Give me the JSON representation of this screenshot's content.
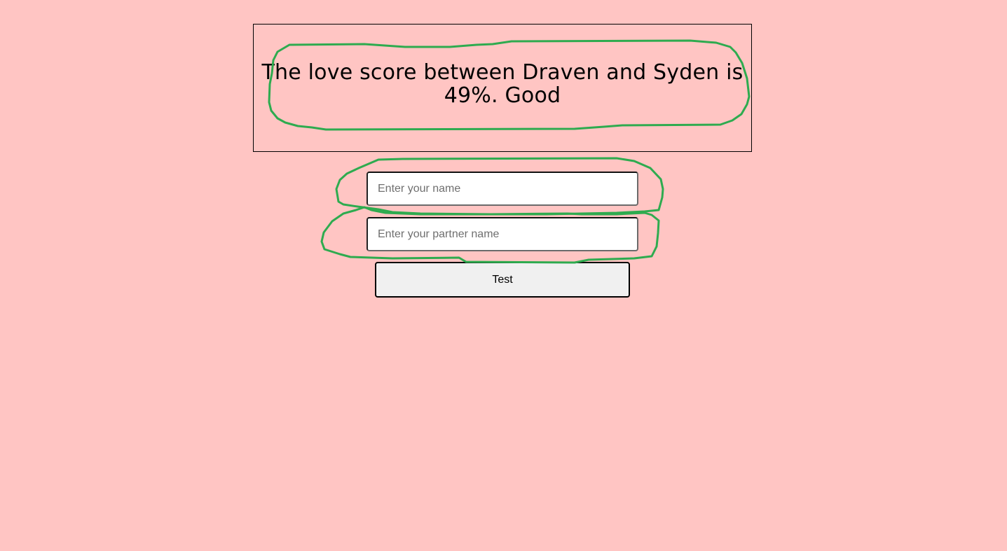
{
  "result": {
    "text": "The love score between Draven and Syden is 49%. Good"
  },
  "form": {
    "name_placeholder": "Enter your name",
    "name_value": "",
    "partner_placeholder": "Enter your partner name",
    "partner_value": "",
    "button_label": "Test"
  },
  "colors": {
    "background": "#ffc5c3",
    "annotation_stroke": "#2eab4f"
  }
}
